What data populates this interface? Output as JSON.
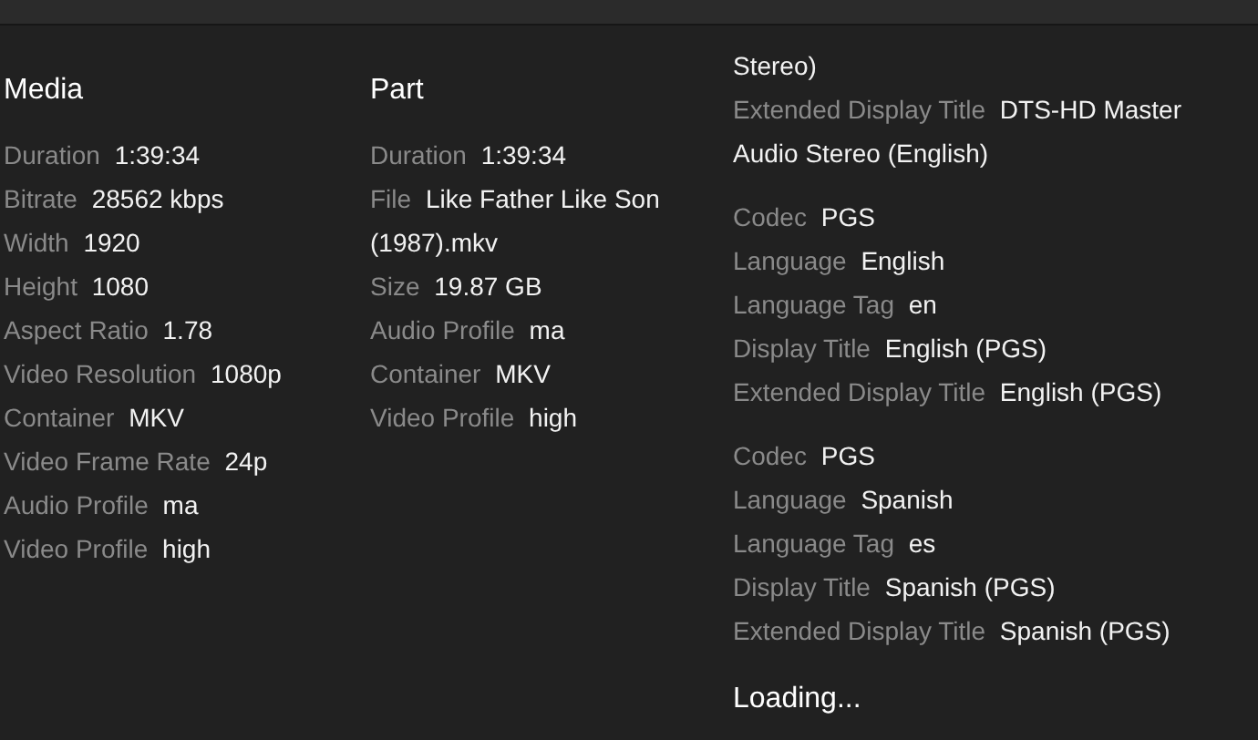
{
  "sections": [
    {
      "title": "Media",
      "fields": [
        {
          "label": "Duration",
          "value": "1:39:34"
        },
        {
          "label": "Bitrate",
          "value": "28562 kbps"
        },
        {
          "label": "Width",
          "value": "1920"
        },
        {
          "label": "Height",
          "value": "1080"
        },
        {
          "label": "Aspect Ratio",
          "value": "1.78"
        },
        {
          "label": "Video Resolution",
          "value": "1080p"
        },
        {
          "label": "Container",
          "value": "MKV"
        },
        {
          "label": "Video Frame Rate",
          "value": "24p"
        },
        {
          "label": "Audio Profile",
          "value": "ma"
        },
        {
          "label": "Video Profile",
          "value": "high"
        }
      ]
    },
    {
      "title": "Part",
      "fields": [
        {
          "label": "Duration",
          "value": "1:39:34"
        },
        {
          "label": "File",
          "value": "Like Father Like Son (1987).mkv"
        },
        {
          "label": "Size",
          "value": "19.87 GB"
        },
        {
          "label": "Audio Profile",
          "value": "ma"
        },
        {
          "label": "Container",
          "value": "MKV"
        },
        {
          "label": "Video Profile",
          "value": "high"
        }
      ]
    }
  ],
  "streams": {
    "continued_text": "Stereo)",
    "groups": [
      {
        "fields": [
          {
            "label": "Extended Display Title",
            "value": "DTS-HD Master Audio Stereo (English)"
          }
        ]
      },
      {
        "fields": [
          {
            "label": "Codec",
            "value": "PGS"
          },
          {
            "label": "Language",
            "value": "English"
          },
          {
            "label": "Language Tag",
            "value": "en"
          },
          {
            "label": "Display Title",
            "value": "English (PGS)"
          },
          {
            "label": "Extended Display Title",
            "value": "English (PGS)"
          }
        ]
      },
      {
        "fields": [
          {
            "label": "Codec",
            "value": "PGS"
          },
          {
            "label": "Language",
            "value": "Spanish"
          },
          {
            "label": "Language Tag",
            "value": "es"
          },
          {
            "label": "Display Title",
            "value": "Spanish (PGS)"
          },
          {
            "label": "Extended Display Title",
            "value": "Spanish (PGS)"
          }
        ]
      }
    ],
    "status": "Loading..."
  }
}
